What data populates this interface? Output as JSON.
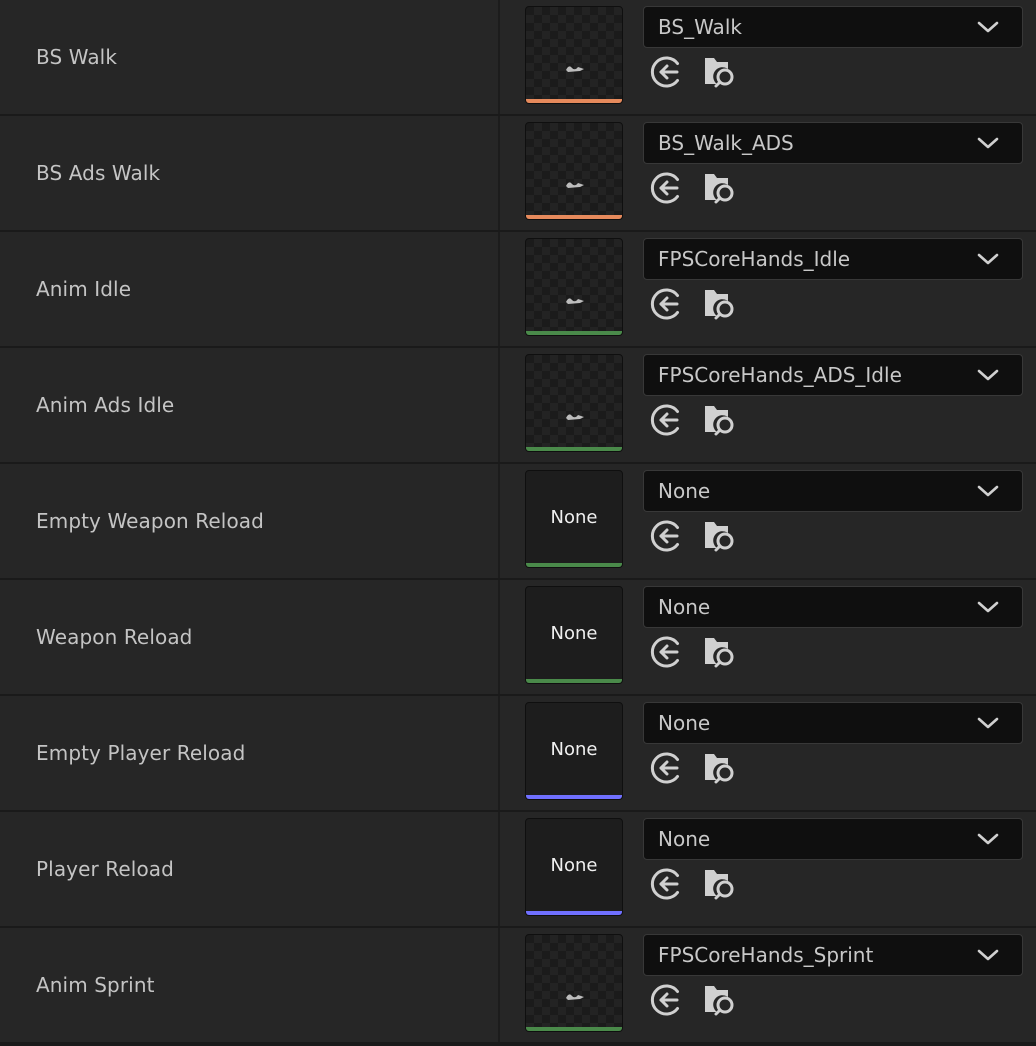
{
  "colors": {
    "orange": "#e68a5c",
    "green": "#4a8a4a",
    "purple": "#7070ff"
  },
  "icons": {
    "use_selected": "arrow-left-circle-icon",
    "browse": "folder-search-icon",
    "dropdown": "chevron-down-icon"
  },
  "rows": [
    {
      "label": "BS Walk",
      "value": "BS_Walk",
      "has_asset": true,
      "thumb_text": "",
      "type_color": "orange"
    },
    {
      "label": "BS Ads Walk",
      "value": "BS_Walk_ADS",
      "has_asset": true,
      "thumb_text": "",
      "type_color": "orange"
    },
    {
      "label": "Anim Idle",
      "value": "FPSCoreHands_Idle",
      "has_asset": true,
      "thumb_text": "",
      "type_color": "green"
    },
    {
      "label": "Anim Ads Idle",
      "value": "FPSCoreHands_ADS_Idle",
      "has_asset": true,
      "thumb_text": "",
      "type_color": "green"
    },
    {
      "label": "Empty Weapon Reload",
      "value": "None",
      "has_asset": false,
      "thumb_text": "None",
      "type_color": "green"
    },
    {
      "label": "Weapon Reload",
      "value": "None",
      "has_asset": false,
      "thumb_text": "None",
      "type_color": "green"
    },
    {
      "label": "Empty Player Reload",
      "value": "None",
      "has_asset": false,
      "thumb_text": "None",
      "type_color": "purple"
    },
    {
      "label": "Player Reload",
      "value": "None",
      "has_asset": false,
      "thumb_text": "None",
      "type_color": "purple"
    },
    {
      "label": "Anim Sprint",
      "value": "FPSCoreHands_Sprint",
      "has_asset": true,
      "thumb_text": "",
      "type_color": "green"
    }
  ]
}
